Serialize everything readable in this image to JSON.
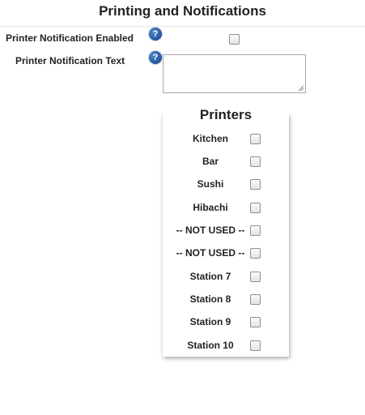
{
  "page": {
    "title": "Printing and Notifications"
  },
  "settings": {
    "notification_enabled_label": "Printer Notification Enabled",
    "notification_text_label": "Printer Notification Text",
    "help_glyph": "?",
    "notification_enabled_checked": false,
    "notification_text_value": ""
  },
  "printers": {
    "title": "Printers",
    "items": [
      {
        "label": "Kitchen",
        "checked": false
      },
      {
        "label": "Bar",
        "checked": false
      },
      {
        "label": "Sushi",
        "checked": false
      },
      {
        "label": "Hibachi",
        "checked": false
      },
      {
        "label": "-- NOT USED --",
        "checked": false
      },
      {
        "label": "-- NOT USED --",
        "checked": false
      },
      {
        "label": "Station 7",
        "checked": false
      },
      {
        "label": "Station 8",
        "checked": false
      },
      {
        "label": "Station 9",
        "checked": false
      },
      {
        "label": "Station 10",
        "checked": false
      }
    ]
  },
  "colors": {
    "help_icon": "#24569a",
    "text": "#222222",
    "checkbox_border": "#8f8f8f"
  }
}
